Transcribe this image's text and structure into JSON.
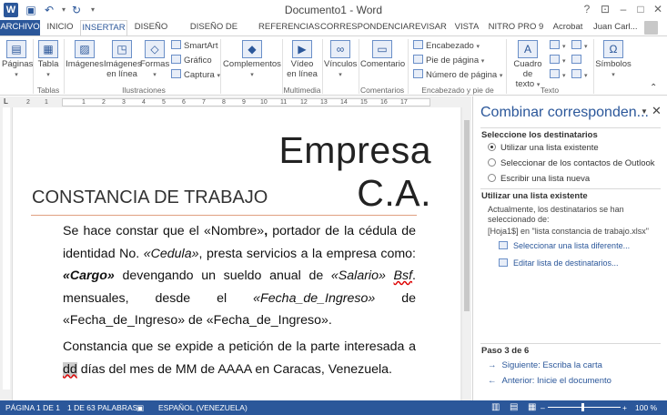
{
  "window": {
    "title": "Documento1 - Word",
    "help": "?",
    "controls": [
      "⊡",
      "–",
      "□",
      "✕"
    ]
  },
  "quick_access": {
    "undo": "↶",
    "redo": "↻",
    "dropdown": "▾"
  },
  "tabs": [
    "ARCHIVO",
    "INICIO",
    "INSERTAR",
    "DISEÑO",
    "DISEÑO DE PÁGINA",
    "REFERENCIAS",
    "CORRESPONDENCIA",
    "REVISAR",
    "VISTA",
    "NITRO PRO 9",
    "Acrobat"
  ],
  "user": {
    "name": "Juan Carl..."
  },
  "ribbon": {
    "paginas": "Páginas",
    "tabla": "Tabla",
    "imagenes": "Imágenes",
    "imagenes_linea_1": "Imágenes",
    "imagenes_linea_2": "en línea",
    "formas": "Formas",
    "smartart": "SmartArt",
    "grafico": "Gráfico",
    "captura": "Captura",
    "complementos": "Complementos",
    "video_1": "Vídeo",
    "video_2": "en línea",
    "vinculos": "Vínculos",
    "comentario": "Comentario",
    "encabezado": "Encabezado",
    "pie_pagina": "Pie de página",
    "numero_pagina": "Número de página",
    "cuadro_texto_1": "Cuadro de",
    "cuadro_texto_2": "texto",
    "simbolos": "Símbolos",
    "groups": {
      "tablas": "Tablas",
      "ilustraciones": "Ilustraciones",
      "multimedia": "Multimedia",
      "comentarios": "Comentarios",
      "encabezado_pie": "Encabezado y pie de página",
      "texto": "Texto"
    }
  },
  "ruler": {
    "numbers": [
      "2",
      "1",
      "1",
      "2",
      "3",
      "4",
      "5",
      "6",
      "7",
      "8",
      "9",
      "10",
      "11",
      "12",
      "13",
      "14",
      "15",
      "16",
      "17"
    ]
  },
  "document": {
    "company": "Empresa C.A.",
    "heading": "CONSTANCIA DE TRABAJO",
    "p1": {
      "t1": "Se hace constar que el «Nombre»",
      "t2": ",",
      "t3": " portador de la cédula de identidad No. ",
      "t4": "«Cedula»",
      "t5": ", presta servicios a la empresa como: ",
      "t6": "«Cargo»",
      "t7": " devengando un sueldo anual de ",
      "t8": "«Salario»",
      "t9": " ",
      "t10": "Bsf",
      "t11": ". mensuales, desde el ",
      "t12": "«Fecha_de_Ingreso»",
      "t13": " de «Fecha_de_Ingreso» de «Fecha_de_Ingreso»."
    },
    "p2": {
      "t1": "Constancia que se expide a petición de la parte interesada a ",
      "t2": "dd",
      "t3": " días del mes de MM de AAAA en Caracas, Venezuela."
    }
  },
  "pane": {
    "title": "Combinar corresponden...",
    "section1": "Seleccione los destinatarios",
    "options": [
      "Utilizar una lista existente",
      "Seleccionar de los contactos de Outlook",
      "Escribir una lista nueva"
    ],
    "selected_option": 0,
    "section2": "Utilizar una lista existente",
    "desc": "Actualmente, los destinatarios se han seleccionado de:",
    "source": "[Hoja1$] en \"lista constancia de trabajo.xlsx\"",
    "link1": "Seleccionar una lista diferente...",
    "link2": "Editar lista de destinatarios...",
    "step": "Paso 3 de 6",
    "next": "Siguiente: Escriba la carta",
    "prev": "Anterior: Inicie el documento"
  },
  "status": {
    "page": "PÁGINA 1 DE 1",
    "words": "1 DE 63 PALABRAS",
    "language": "ESPAÑOL (VENEZUELA)",
    "zoom": "100 %",
    "zoom_minus": "–",
    "zoom_plus": "+"
  },
  "colors": {
    "accent": "#2b579a",
    "heading_rule": "#e0a080"
  }
}
